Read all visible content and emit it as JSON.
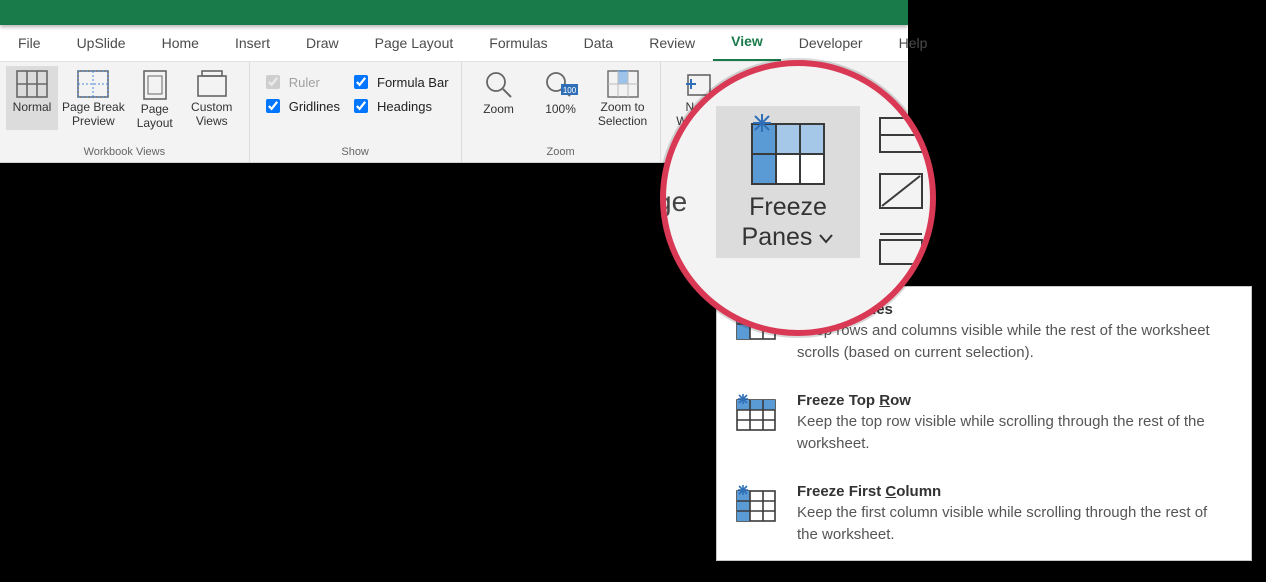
{
  "tabs": [
    "File",
    "UpSlide",
    "Home",
    "Insert",
    "Draw",
    "Page Layout",
    "Formulas",
    "Data",
    "Review",
    "View",
    "Developer",
    "Help"
  ],
  "active_tab": "View",
  "groups": {
    "workbook_views": {
      "label": "Workbook Views",
      "normal": "Normal",
      "page_break": "Page Break\nPreview",
      "page_layout": "Page\nLayout",
      "custom_views": "Custom\nViews"
    },
    "show": {
      "label": "Show",
      "ruler": "Ruler",
      "formula_bar": "Formula Bar",
      "gridlines": "Gridlines",
      "headings": "Headings"
    },
    "zoom_group": {
      "label": "Zoom",
      "zoom": "Zoom",
      "hundred": "100%",
      "to_sel": "Zoom to\nSelection"
    },
    "window": {
      "new_window": "New\nWindow"
    }
  },
  "mag": {
    "left_text": "ge",
    "freeze_l1": "Freeze",
    "freeze_l2": "Panes"
  },
  "menu": [
    {
      "title": "Freeze Panes",
      "u_letter": "F",
      "rest": "reeze Panes",
      "desc": "Keep rows and columns visible while the rest of the worksheet scrolls (based on current selection)."
    },
    {
      "title": "Freeze Top Row",
      "u_letter": "R",
      "pre": "Freeze Top ",
      "post": "ow",
      "desc": "Keep the top row visible while scrolling through the rest of the worksheet."
    },
    {
      "title": "Freeze First Column",
      "u_letter": "C",
      "pre": "Freeze First ",
      "post": "olumn",
      "desc": "Keep the first column visible while scrolling through the rest of the worksheet."
    }
  ]
}
